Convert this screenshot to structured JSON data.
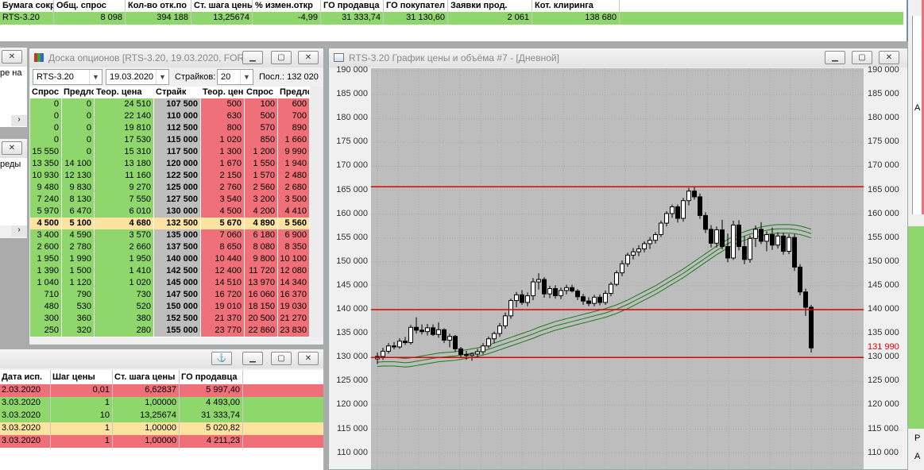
{
  "top_table": {
    "headers": [
      "Бумага сокр.",
      "Общ. спрос",
      "Кол-во отк.по",
      "Ст. шага цены",
      "% измен.откр",
      "ГО продавца",
      "ГО покупател",
      "Заявки прод.",
      "Кот. клиринга"
    ],
    "row": [
      "RTS-3.20",
      "8 098",
      "394 188",
      "13,25674",
      "-4,99",
      "31 333,74",
      "31 130,60",
      "2 061",
      "138 680"
    ]
  },
  "left_fragments": {
    "text1": "ре на",
    "text2": "реды"
  },
  "options_board": {
    "title": "Доска опционов [RTS-3.20, 19.03.2020, FOR...",
    "controls": {
      "instrument": "RTS-3.20",
      "date": "19.03.2020",
      "strikes_label": "Страйков:",
      "strikes_value": "20",
      "last_label": "Посл.: 132 020"
    },
    "headers": [
      "Спрос",
      "Предлс",
      "Теор. цена",
      "Страйк",
      "Теор. цен",
      "Спрос",
      "Предло"
    ],
    "rows": [
      [
        "0",
        "0",
        "24 510",
        "107 500",
        "500",
        "100",
        "600"
      ],
      [
        "0",
        "0",
        "22 140",
        "110 000",
        "630",
        "500",
        "700"
      ],
      [
        "0",
        "0",
        "19 810",
        "112 500",
        "800",
        "570",
        "890"
      ],
      [
        "0",
        "0",
        "17 530",
        "115 000",
        "1 020",
        "850",
        "1 660"
      ],
      [
        "15 550",
        "0",
        "15 310",
        "117 500",
        "1 300",
        "1 200",
        "9 990"
      ],
      [
        "13 350",
        "14 100",
        "13 180",
        "120 000",
        "1 670",
        "1 550",
        "1 940"
      ],
      [
        "10 930",
        "12 130",
        "11 160",
        "122 500",
        "2 150",
        "1 570",
        "2 480"
      ],
      [
        "9 480",
        "9 830",
        "9 270",
        "125 000",
        "2 760",
        "2 560",
        "2 680"
      ],
      [
        "7 240",
        "8 130",
        "7 550",
        "127 500",
        "3 540",
        "3 200",
        "3 500"
      ],
      [
        "5 970",
        "6 470",
        "6 010",
        "130 000",
        "4 500",
        "4 200",
        "4 410"
      ],
      [
        "4 500",
        "5 100",
        "4 680",
        "132 500",
        "5 670",
        "4 890",
        "5 560"
      ],
      [
        "3 400",
        "4 590",
        "3 570",
        "135 000",
        "7 060",
        "6 180",
        "6 900"
      ],
      [
        "2 600",
        "2 780",
        "2 660",
        "137 500",
        "8 650",
        "8 080",
        "8 350"
      ],
      [
        "1 950",
        "1 990",
        "1 950",
        "140 000",
        "10 440",
        "9 800",
        "10 100"
      ],
      [
        "1 390",
        "1 500",
        "1 410",
        "142 500",
        "12 400",
        "11 720",
        "12 080"
      ],
      [
        "1 040",
        "1 120",
        "1 020",
        "145 000",
        "14 510",
        "13 970",
        "14 340"
      ],
      [
        "710",
        "790",
        "730",
        "147 500",
        "16 720",
        "16 060",
        "16 370"
      ],
      [
        "480",
        "530",
        "520",
        "150 000",
        "19 010",
        "18 150",
        "19 030"
      ],
      [
        "300",
        "360",
        "380",
        "152 500",
        "21 370",
        "20 500",
        "21 270"
      ],
      [
        "250",
        "320",
        "280",
        "155 000",
        "23 770",
        "22 860",
        "23 830"
      ]
    ]
  },
  "bottom_table": {
    "headers": [
      "Дата исп.",
      "Шаг цены",
      "Ст. шага цены",
      "ГО продавца"
    ],
    "rows": [
      [
        "2.03.2020",
        "0,01",
        "6,62837",
        "5 997,40"
      ],
      [
        "3.03.2020",
        "1",
        "1,00000",
        "4 493,00"
      ],
      [
        "3.03.2020",
        "10",
        "13,25674",
        "31 333,74"
      ],
      [
        "3.03.2020",
        "1",
        "1,00000",
        "5 020,82"
      ],
      [
        "3.03.2020",
        "1",
        "1,00000",
        "4 211,23"
      ]
    ],
    "row_colors": [
      "#f0707a",
      "#8fd66d",
      "#8fd66d",
      "#fce3a0",
      "#f0707a"
    ]
  },
  "chart_window": {
    "title": "RTS-3.20 График цены и объёма #7 - [Дневной]",
    "y_ticks": [
      "190 000",
      "185 000",
      "180 000",
      "175 000",
      "170 000",
      "165 000",
      "160 000",
      "155 000",
      "150 000",
      "145 000",
      "140 000",
      "135 000",
      "130 000",
      "125 000",
      "120 000",
      "115 000",
      "110 000"
    ],
    "last_price_label": "131 990"
  },
  "right_fragments": {
    "p": "P",
    "a1": "A",
    "a2": "A"
  },
  "chart_data": {
    "type": "candlestick",
    "ylim": [
      107500,
      192000
    ],
    "y_ticks": [
      110000,
      115000,
      120000,
      125000,
      130000,
      135000,
      140000,
      145000,
      150000,
      155000,
      160000,
      165000,
      170000,
      175000,
      180000,
      185000,
      190000
    ],
    "horizontal_lines": [
      165700,
      140000,
      130000
    ],
    "last_price": 131990,
    "candles": [
      [
        129700,
        131000,
        128600,
        130200
      ],
      [
        130200,
        132000,
        129500,
        131300
      ],
      [
        131300,
        133000,
        130800,
        132400
      ],
      [
        132400,
        133200,
        131700,
        132200
      ],
      [
        132200,
        134000,
        131800,
        133400
      ],
      [
        133400,
        134300,
        132600,
        133100
      ],
      [
        133100,
        136800,
        132700,
        136300
      ],
      [
        136300,
        138400,
        135000,
        135700
      ],
      [
        135700,
        136900,
        134800,
        135400
      ],
      [
        135400,
        137000,
        134600,
        136200
      ],
      [
        136200,
        136900,
        134500,
        134800
      ],
      [
        134800,
        137300,
        134100,
        135800
      ],
      [
        135800,
        136100,
        133000,
        133600
      ],
      [
        133600,
        135000,
        132100,
        134400
      ],
      [
        134400,
        134700,
        131200,
        131800
      ],
      [
        131800,
        132200,
        130100,
        130600
      ],
      [
        130600,
        131400,
        129500,
        130400
      ],
      [
        130400,
        131000,
        129300,
        130700
      ],
      [
        130700,
        131800,
        130100,
        131200
      ],
      [
        131200,
        133000,
        130600,
        132400
      ],
      [
        132400,
        134400,
        131900,
        133900
      ],
      [
        133900,
        135400,
        133000,
        135000
      ],
      [
        135000,
        137200,
        134300,
        136600
      ],
      [
        136600,
        139400,
        136000,
        138700
      ],
      [
        138700,
        142300,
        138100,
        141900
      ],
      [
        141900,
        143700,
        140500,
        143100
      ],
      [
        143100,
        144100,
        141000,
        141500
      ],
      [
        141500,
        143600,
        140700,
        142900
      ],
      [
        142900,
        146600,
        142000,
        145800
      ],
      [
        145800,
        147600,
        144200,
        146300
      ],
      [
        146300,
        146800,
        142500,
        143300
      ],
      [
        143300,
        145000,
        142400,
        144400
      ],
      [
        144400,
        145100,
        142300,
        142900
      ],
      [
        142900,
        144600,
        142200,
        144000
      ],
      [
        144000,
        145200,
        143200,
        144600
      ],
      [
        144600,
        145200,
        143600,
        143900
      ],
      [
        143900,
        144300,
        142000,
        142700
      ],
      [
        142700,
        143300,
        141000,
        141800
      ],
      [
        141800,
        142600,
        140700,
        141300
      ],
      [
        141300,
        143100,
        140700,
        142600
      ],
      [
        142600,
        143200,
        140900,
        141500
      ],
      [
        141500,
        144000,
        141000,
        143400
      ],
      [
        143400,
        145800,
        142800,
        145300
      ],
      [
        145300,
        148200,
        144900,
        147700
      ],
      [
        147700,
        150300,
        147000,
        149600
      ],
      [
        149600,
        151900,
        149000,
        151400
      ],
      [
        151400,
        152900,
        150500,
        152100
      ],
      [
        152100,
        153500,
        151200,
        152700
      ],
      [
        152700,
        154300,
        152000,
        153800
      ],
      [
        153800,
        155200,
        152700,
        154500
      ],
      [
        154500,
        156200,
        153800,
        155700
      ],
      [
        155700,
        158600,
        155200,
        158100
      ],
      [
        158100,
        160600,
        157400,
        160100
      ],
      [
        160100,
        162000,
        159200,
        161500
      ],
      [
        161500,
        162000,
        158200,
        159100
      ],
      [
        159100,
        163400,
        158400,
        162800
      ],
      [
        162800,
        165500,
        161800,
        164800
      ],
      [
        164800,
        165800,
        163000,
        163600
      ],
      [
        163600,
        164300,
        159000,
        159700
      ],
      [
        159700,
        160400,
        156000,
        156800
      ],
      [
        156800,
        157700,
        153000,
        153900
      ],
      [
        153900,
        157400,
        153000,
        156700
      ],
      [
        156700,
        158800,
        152600,
        153200
      ],
      [
        153200,
        155900,
        149900,
        150800
      ],
      [
        150800,
        158600,
        150400,
        157700
      ],
      [
        157700,
        158700,
        152400,
        153200
      ],
      [
        153200,
        155400,
        149500,
        150500
      ],
      [
        150500,
        155500,
        149800,
        154900
      ],
      [
        154900,
        157600,
        153100,
        156800
      ],
      [
        156800,
        158300,
        153700,
        154300
      ],
      [
        154300,
        156400,
        152200,
        155700
      ],
      [
        155700,
        157200,
        152500,
        153500
      ],
      [
        153500,
        156200,
        152800,
        155400
      ],
      [
        155400,
        156100,
        151500,
        152200
      ],
      [
        152200,
        155800,
        151600,
        155100
      ],
      [
        155100,
        155800,
        148100,
        148900
      ],
      [
        148900,
        149500,
        143000,
        143700
      ],
      [
        143700,
        144400,
        138700,
        140500
      ],
      [
        140500,
        141000,
        131000,
        131990
      ]
    ],
    "ma_lines": {
      "upper": [
        129900,
        130000,
        130000,
        130000,
        129900,
        129800,
        129900,
        130100,
        130300,
        130500,
        130700,
        130900,
        131000,
        131100,
        131200,
        131400,
        131600,
        131800,
        132000,
        132300,
        132600,
        133000,
        133400,
        133800,
        134200,
        134600,
        135000,
        135400,
        135800,
        136300,
        136700,
        137100,
        137500,
        137800,
        138100,
        138400,
        138700,
        139000,
        139300,
        139600,
        139900,
        140200,
        140600,
        141000,
        141500,
        142000,
        142600,
        143200,
        143800,
        144400,
        145000,
        145700,
        146400,
        147100,
        147800,
        148500,
        149300,
        150100,
        150900,
        151700,
        152500,
        153300,
        154000,
        154700,
        155300,
        155900,
        156300,
        156700,
        157000,
        157300,
        157500,
        157700,
        157800,
        157800,
        157800,
        157700,
        157500,
        157200,
        156800
      ],
      "middle": [
        129000,
        129100,
        129100,
        129100,
        129000,
        128900,
        129000,
        129200,
        129400,
        129600,
        129800,
        130000,
        130100,
        130200,
        130300,
        130500,
        130700,
        130900,
        131100,
        131400,
        131700,
        132100,
        132500,
        132900,
        133300,
        133700,
        134100,
        134500,
        134900,
        135400,
        135800,
        136200,
        136600,
        136900,
        137200,
        137500,
        137800,
        138100,
        138400,
        138700,
        139000,
        139300,
        139700,
        140100,
        140600,
        141100,
        141700,
        142300,
        142900,
        143500,
        144100,
        144800,
        145500,
        146200,
        146900,
        147600,
        148400,
        149200,
        150000,
        150800,
        151600,
        152400,
        153100,
        153800,
        154400,
        155000,
        155400,
        155800,
        156100,
        156400,
        156600,
        156800,
        156900,
        156900,
        156900,
        156800,
        156600,
        156300,
        155900
      ],
      "lower": [
        128100,
        128200,
        128200,
        128200,
        128100,
        128000,
        128100,
        128300,
        128500,
        128700,
        128900,
        129100,
        129200,
        129300,
        129400,
        129600,
        129800,
        130000,
        130200,
        130500,
        130800,
        131200,
        131600,
        132000,
        132400,
        132800,
        133200,
        133600,
        134000,
        134500,
        134900,
        135300,
        135700,
        136000,
        136300,
        136600,
        136900,
        137200,
        137500,
        137800,
        138100,
        138400,
        138800,
        139200,
        139700,
        140200,
        140800,
        141400,
        142000,
        142600,
        143200,
        143900,
        144600,
        145300,
        146000,
        146700,
        147500,
        148300,
        149100,
        149900,
        150700,
        151500,
        152200,
        152900,
        153500,
        154100,
        154500,
        154900,
        155200,
        155500,
        155700,
        155900,
        156000,
        156000,
        156000,
        155900,
        155700,
        155400,
        155000
      ]
    }
  }
}
